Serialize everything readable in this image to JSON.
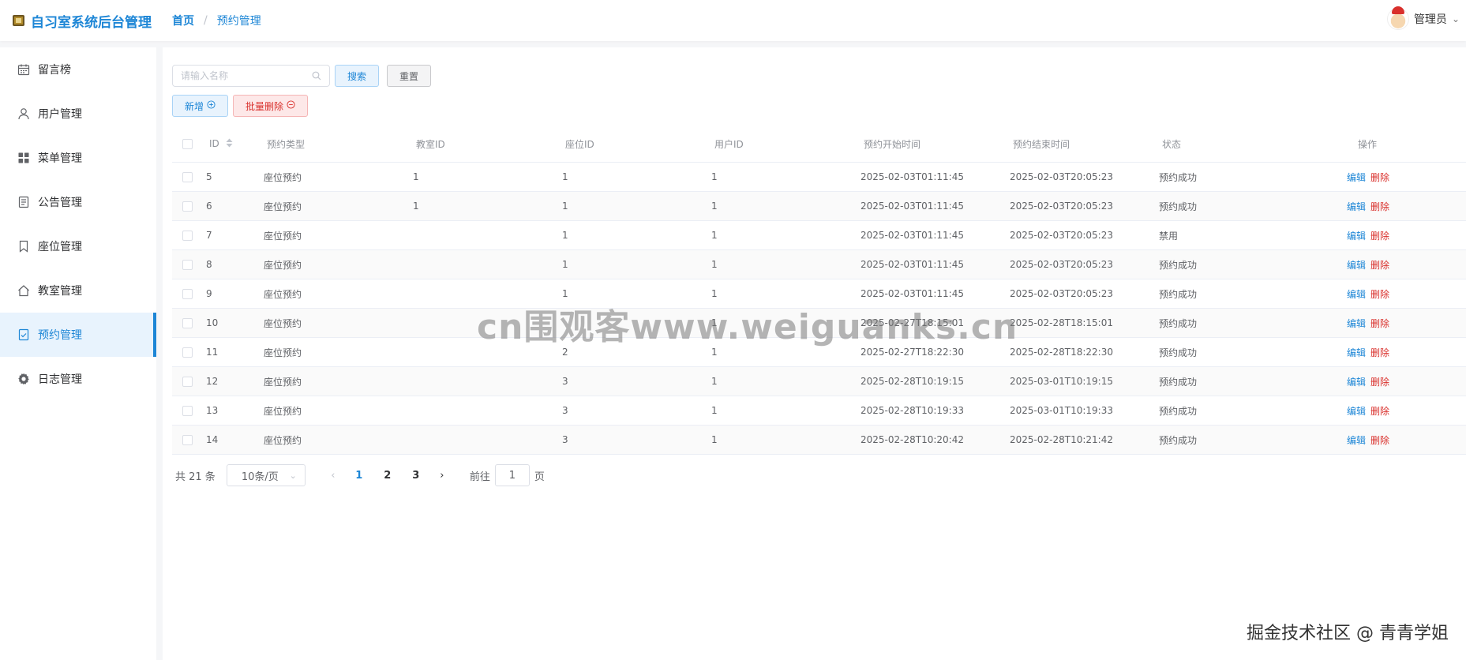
{
  "app": {
    "title": "自习室系统后台管理"
  },
  "breadcrumb": {
    "home": "首页",
    "separator": "/",
    "current": "预约管理"
  },
  "user": {
    "name": "管理员"
  },
  "sidebar": {
    "items": [
      {
        "label": "留言榜",
        "icon": "calendar-icon"
      },
      {
        "label": "用户管理",
        "icon": "user-icon"
      },
      {
        "label": "菜单管理",
        "icon": "grid-icon"
      },
      {
        "label": "公告管理",
        "icon": "document-icon"
      },
      {
        "label": "座位管理",
        "icon": "bookmark-icon"
      },
      {
        "label": "教室管理",
        "icon": "home-icon"
      },
      {
        "label": "预约管理",
        "icon": "check-document-icon",
        "active": true
      },
      {
        "label": "日志管理",
        "icon": "gear-icon"
      }
    ]
  },
  "toolbar": {
    "search_placeholder": "请输入名称",
    "search_label": "搜索",
    "reset_label": "重置",
    "add_label": "新增",
    "batch_delete_label": "批量删除"
  },
  "table": {
    "headers": {
      "id": "ID",
      "type": "预约类型",
      "room_id": "教室ID",
      "seat_id": "座位ID",
      "user_id": "用户ID",
      "start_time": "预约开始时间",
      "end_time": "预约结束时间",
      "status": "状态",
      "ops": "操作"
    },
    "edit_label": "编辑",
    "delete_label": "删除",
    "rows": [
      {
        "id": "5",
        "type": "座位预约",
        "room": "1",
        "seat": "1",
        "user": "1",
        "start": "2025-02-03T01:11:45",
        "end": "2025-02-03T20:05:23",
        "status": "预约成功"
      },
      {
        "id": "6",
        "type": "座位预约",
        "room": "1",
        "seat": "1",
        "user": "1",
        "start": "2025-02-03T01:11:45",
        "end": "2025-02-03T20:05:23",
        "status": "预约成功"
      },
      {
        "id": "7",
        "type": "座位预约",
        "room": "",
        "seat": "1",
        "user": "1",
        "start": "2025-02-03T01:11:45",
        "end": "2025-02-03T20:05:23",
        "status": "禁用"
      },
      {
        "id": "8",
        "type": "座位预约",
        "room": "",
        "seat": "1",
        "user": "1",
        "start": "2025-02-03T01:11:45",
        "end": "2025-02-03T20:05:23",
        "status": "预约成功"
      },
      {
        "id": "9",
        "type": "座位预约",
        "room": "",
        "seat": "1",
        "user": "1",
        "start": "2025-02-03T01:11:45",
        "end": "2025-02-03T20:05:23",
        "status": "预约成功"
      },
      {
        "id": "10",
        "type": "座位预约",
        "room": "",
        "seat": "",
        "user": "1",
        "start": "2025-02-27T18:15:01",
        "end": "2025-02-28T18:15:01",
        "status": "预约成功"
      },
      {
        "id": "11",
        "type": "座位预约",
        "room": "",
        "seat": "2",
        "user": "1",
        "start": "2025-02-27T18:22:30",
        "end": "2025-02-28T18:22:30",
        "status": "预约成功"
      },
      {
        "id": "12",
        "type": "座位预约",
        "room": "",
        "seat": "3",
        "user": "1",
        "start": "2025-02-28T10:19:15",
        "end": "2025-03-01T10:19:15",
        "status": "预约成功"
      },
      {
        "id": "13",
        "type": "座位预约",
        "room": "",
        "seat": "3",
        "user": "1",
        "start": "2025-02-28T10:19:33",
        "end": "2025-03-01T10:19:33",
        "status": "预约成功"
      },
      {
        "id": "14",
        "type": "座位预约",
        "room": "",
        "seat": "3",
        "user": "1",
        "start": "2025-02-28T10:20:42",
        "end": "2025-02-28T10:21:42",
        "status": "预约成功"
      }
    ]
  },
  "pagination": {
    "total": "共 21 条",
    "page_size": "10条/页",
    "pages": [
      "1",
      "2",
      "3"
    ],
    "current_page": "1",
    "goto_prefix": "前往",
    "goto_value": "1",
    "goto_suffix": "页"
  },
  "overlay": {
    "watermark": "cn围观客www.weiguanks.cn",
    "credit": "掘金技术社区 @ 青青学姐"
  },
  "colors": {
    "accent": "#1d86d6",
    "danger": "#d9302c",
    "active_bg": "#e8f3fd"
  }
}
